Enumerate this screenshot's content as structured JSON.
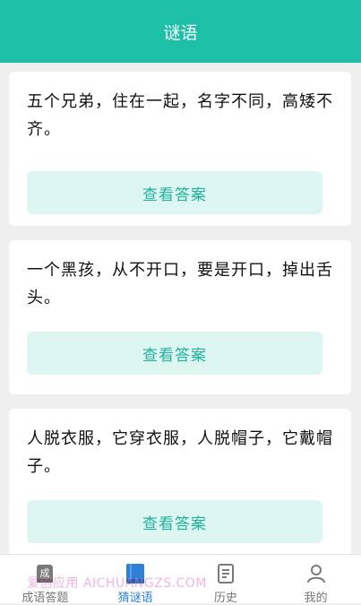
{
  "header": {
    "title": "谜语"
  },
  "riddles": [
    {
      "text": "五个兄弟，住在一起，名字不同，高矮不齐。",
      "button": "查看答案"
    },
    {
      "text": "一个黑孩，从不开口，要是开口，掉出舌头。",
      "button": "查看答案"
    },
    {
      "text": "人脱衣服，它穿衣服，人脱帽子，它戴帽子。",
      "button": "查看答案"
    }
  ],
  "tabs": [
    {
      "label": "成语答题",
      "icon": "idiom-card-icon",
      "icon_text": "成"
    },
    {
      "label": "猜谜语",
      "icon": "book-icon"
    },
    {
      "label": "历史",
      "icon": "document-icon"
    },
    {
      "label": "我的",
      "icon": "user-icon"
    }
  ],
  "active_tab": "猜谜语",
  "watermark": "爱创应用 AICHUANGZS.COM",
  "colors": {
    "primary": "#1dbfa6",
    "button_bg": "#ddf6f1",
    "active_tab": "#2e7fd8"
  }
}
